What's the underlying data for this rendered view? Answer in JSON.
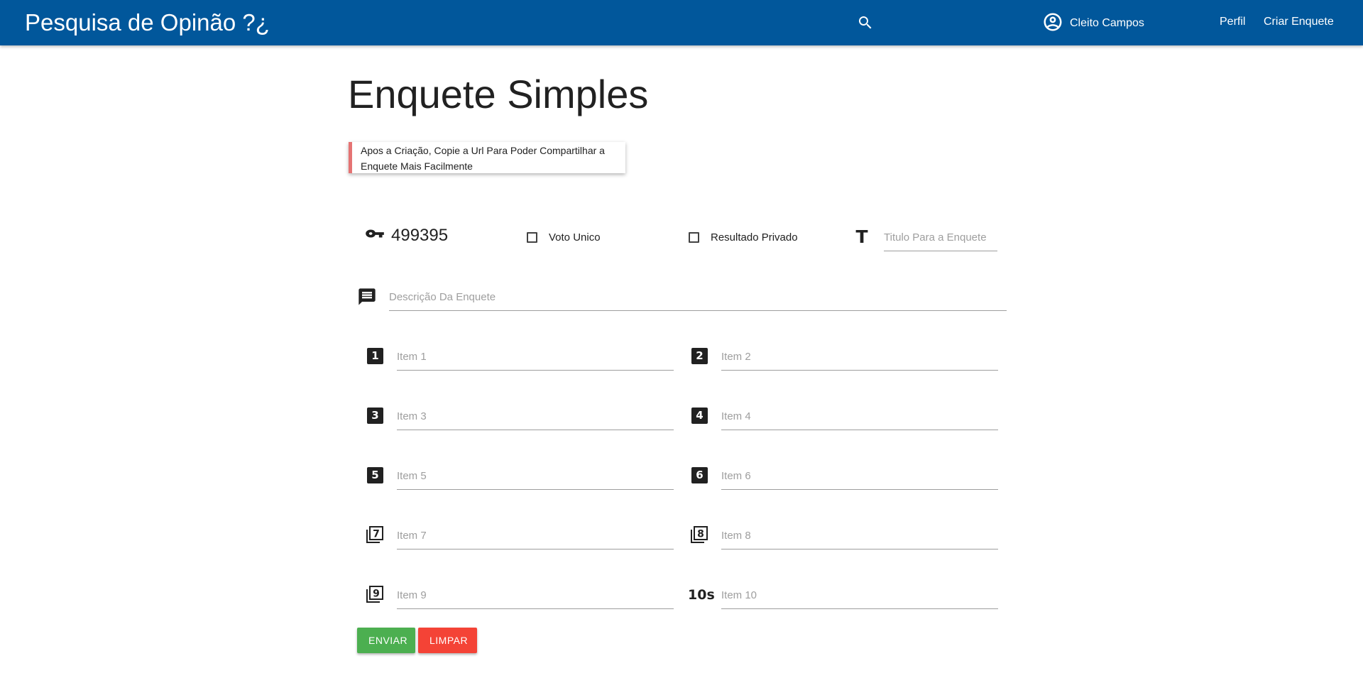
{
  "navbar": {
    "brand": "Pesquisa de Opinão ?¿",
    "user_name": "Cleito Campos",
    "links": {
      "perfil": "Perfil",
      "criar_enquete": "Criar Enquete"
    }
  },
  "page": {
    "title": "Enquete Simples",
    "notice": "Apos a Criação, Copie a Url Para Poder Compartilhar a Enquete Mais Facilmente"
  },
  "form": {
    "code": "499395",
    "voto_unico_label": "Voto Unico",
    "voto_unico_checked": false,
    "resultado_privado_label": "Resultado Privado",
    "resultado_privado_checked": false,
    "titulo_placeholder": "Titulo Para a Enquete",
    "titulo_value": "",
    "descricao_placeholder": "Descrição Da Enquete",
    "descricao_value": "",
    "items": [
      {
        "badge": "1",
        "placeholder": "Item 1",
        "value": ""
      },
      {
        "badge": "2",
        "placeholder": "Item 2",
        "value": ""
      },
      {
        "badge": "3",
        "placeholder": "Item 3",
        "value": ""
      },
      {
        "badge": "4",
        "placeholder": "Item 4",
        "value": ""
      },
      {
        "badge": "5",
        "placeholder": "Item 5",
        "value": ""
      },
      {
        "badge": "6",
        "placeholder": "Item 6",
        "value": ""
      },
      {
        "badge": "7",
        "placeholder": "Item 7",
        "value": ""
      },
      {
        "badge": "8",
        "placeholder": "Item 8",
        "value": ""
      },
      {
        "badge": "9",
        "placeholder": "Item 9",
        "value": ""
      },
      {
        "badge": "10s",
        "placeholder": "Item 10",
        "value": ""
      }
    ],
    "enviar_label": "ENVIAR",
    "limpar_label": "LIMPAR"
  },
  "colors": {
    "navbar": "#01579b",
    "notice_border": "#e57373",
    "enviar": "#4caf50",
    "limpar": "#f44336"
  },
  "icons": {
    "search": "search-icon",
    "user": "account-circle-icon",
    "code": "vpn-key-icon",
    "title": "text-format-icon",
    "description": "message-icon"
  }
}
